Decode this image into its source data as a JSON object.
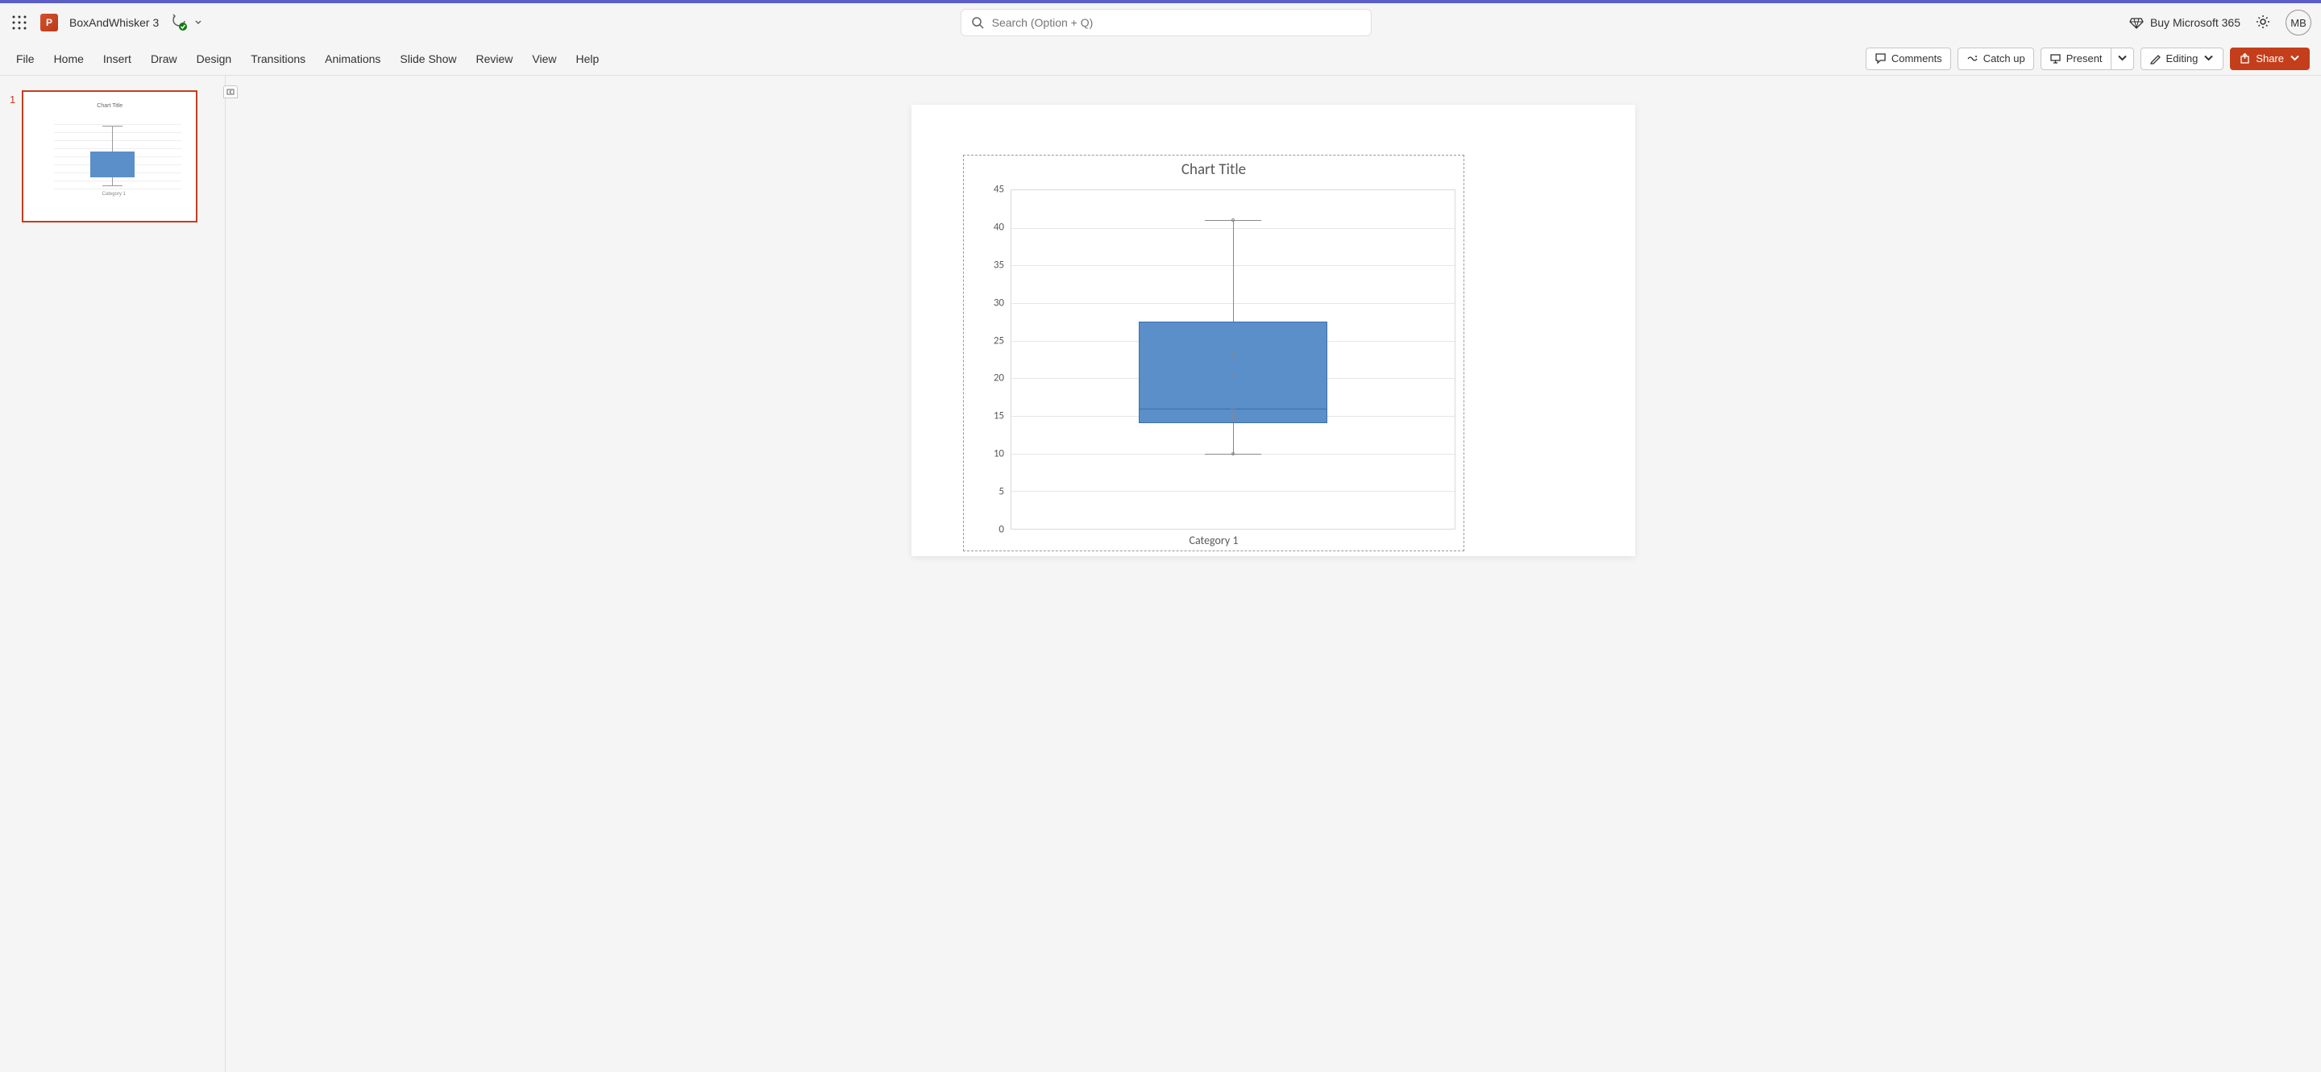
{
  "titlebar": {
    "doc_name": "BoxAndWhisker 3",
    "search_placeholder": "Search (Option + Q)",
    "buy_label": "Buy Microsoft 365",
    "avatar_initials": "MB"
  },
  "ribbon": {
    "tabs": [
      "File",
      "Home",
      "Insert",
      "Draw",
      "Design",
      "Transitions",
      "Animations",
      "Slide Show",
      "Review",
      "View",
      "Help"
    ],
    "comments": "Comments",
    "catchup": "Catch up",
    "present": "Present",
    "editing": "Editing",
    "share": "Share"
  },
  "slidepanel": {
    "slides": [
      {
        "num": "1"
      }
    ]
  },
  "chart_data": {
    "type": "boxplot",
    "title": "Chart Title",
    "categories": [
      "Category 1"
    ],
    "series": [
      {
        "category": "Category 1",
        "min": 10,
        "q1": 14,
        "median": 16,
        "q3": 27.5,
        "max": 41,
        "mean": 20.5,
        "points": [
          10,
          15,
          16,
          23,
          41,
          14.7
        ]
      }
    ],
    "ylabel": "",
    "xlabel": "",
    "ylim": [
      0,
      45
    ],
    "yticks": [
      0,
      5,
      10,
      15,
      20,
      25,
      30,
      35,
      40,
      45
    ]
  }
}
